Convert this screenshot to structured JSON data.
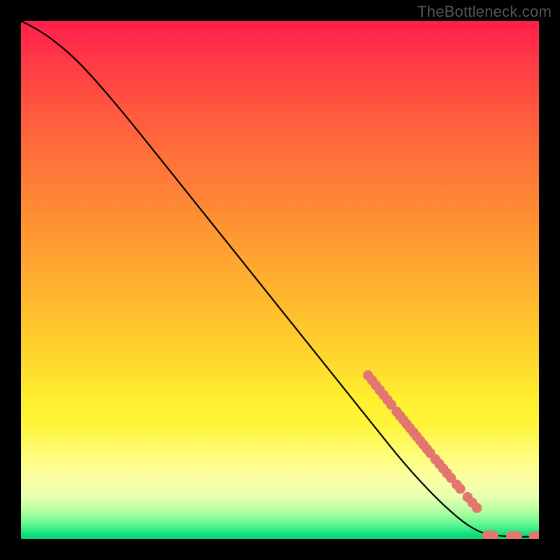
{
  "watermark": "TheBottleneck.com",
  "colors": {
    "dot": "#e3766f",
    "curve": "#000000",
    "frame_bg": "#000000",
    "gradient_top": "#ff1e4c",
    "gradient_bottom": "#07d277"
  },
  "chart_data": {
    "type": "line",
    "title": "",
    "xlabel": "",
    "ylabel": "",
    "xlim": [
      0,
      100
    ],
    "ylim": [
      0,
      100
    ],
    "grid": false,
    "curve_points": [
      {
        "x": 0,
        "y": 100
      },
      {
        "x": 3,
        "y": 98.5
      },
      {
        "x": 6,
        "y": 96.5
      },
      {
        "x": 10,
        "y": 93.2
      },
      {
        "x": 14,
        "y": 89.0
      },
      {
        "x": 20,
        "y": 82.0
      },
      {
        "x": 30,
        "y": 69.5
      },
      {
        "x": 40,
        "y": 57.0
      },
      {
        "x": 50,
        "y": 44.5
      },
      {
        "x": 60,
        "y": 32.0
      },
      {
        "x": 68,
        "y": 22.0
      },
      {
        "x": 74,
        "y": 14.5
      },
      {
        "x": 80,
        "y": 8.0
      },
      {
        "x": 85,
        "y": 3.5
      },
      {
        "x": 88,
        "y": 1.6
      },
      {
        "x": 90,
        "y": 0.9
      },
      {
        "x": 93,
        "y": 0.55
      },
      {
        "x": 96,
        "y": 0.45
      },
      {
        "x": 100,
        "y": 0.4
      }
    ],
    "dot_segments": [
      {
        "start_x": 67,
        "start_y": 31.6,
        "end_x": 71.5,
        "end_y": 25.9,
        "count": 7
      },
      {
        "start_x": 72.5,
        "start_y": 24.6,
        "end_x": 79.0,
        "end_y": 16.6,
        "count": 11
      },
      {
        "start_x": 80.0,
        "start_y": 15.4,
        "end_x": 83.0,
        "end_y": 11.8,
        "count": 5
      },
      {
        "start_x": 84.1,
        "start_y": 10.5,
        "end_x": 84.8,
        "end_y": 9.7,
        "count": 2
      },
      {
        "start_x": 86.2,
        "start_y": 8.1,
        "end_x": 88.0,
        "end_y": 6.0,
        "count": 3
      }
    ],
    "dots_isolated": [
      {
        "x": 90.0,
        "y": 0.7
      },
      {
        "x": 91.2,
        "y": 0.7
      },
      {
        "x": 94.6,
        "y": 0.55
      },
      {
        "x": 95.8,
        "y": 0.55
      },
      {
        "x": 99.0,
        "y": 0.5
      },
      {
        "x": 100.0,
        "y": 0.5
      }
    ]
  }
}
